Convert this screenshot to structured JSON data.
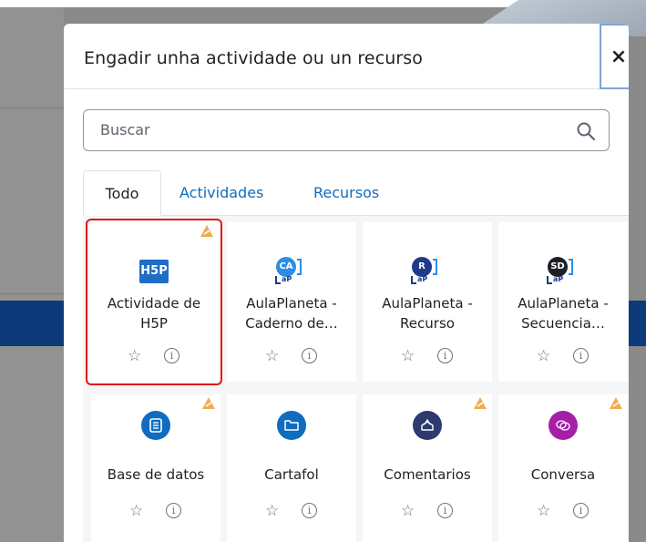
{
  "modal": {
    "title": "Engadir unha actividade ou un recurso",
    "close_label": "×"
  },
  "search": {
    "placeholder": "Buscar"
  },
  "tabs": [
    {
      "label": "Todo",
      "active": true
    },
    {
      "label": "Actividades",
      "active": false
    },
    {
      "label": "Recursos",
      "active": false
    }
  ],
  "cards": [
    {
      "name_line1": "Actividade de",
      "name_line2": "H5P",
      "icon": "h5p-icon",
      "warning": true,
      "selected": true
    },
    {
      "name_line1": "AulaPlaneta -",
      "name_line2": "Caderno de…",
      "icon": "aulaplaneta-ca-icon",
      "badge": "CA",
      "warning": false
    },
    {
      "name_line1": "AulaPlaneta -",
      "name_line2": "Recurso",
      "icon": "aulaplaneta-r-icon",
      "badge": "R",
      "warning": false
    },
    {
      "name_line1": "AulaPlaneta -",
      "name_line2": "Secuencia…",
      "icon": "aulaplaneta-sd-icon",
      "badge": "SD",
      "warning": false
    },
    {
      "name_line1": "Base de datos",
      "icon": "database-icon",
      "warning": true
    },
    {
      "name_line1": "Cartafol",
      "icon": "folder-icon",
      "warning": false
    },
    {
      "name_line1": "Comentarios",
      "icon": "feedback-icon",
      "warning": true
    },
    {
      "name_line1": "Conversa",
      "icon": "chat-icon",
      "warning": true
    }
  ],
  "colors": {
    "link": "#0f6cbf",
    "selected_outline": "#e01b1b",
    "warning": "#f0ad4e",
    "h5p_blue": "#1f6dc4",
    "database_blue": "#0f6cbf",
    "feedback_navy": "#2d3a6e",
    "chat_purple": "#a51fa7"
  }
}
